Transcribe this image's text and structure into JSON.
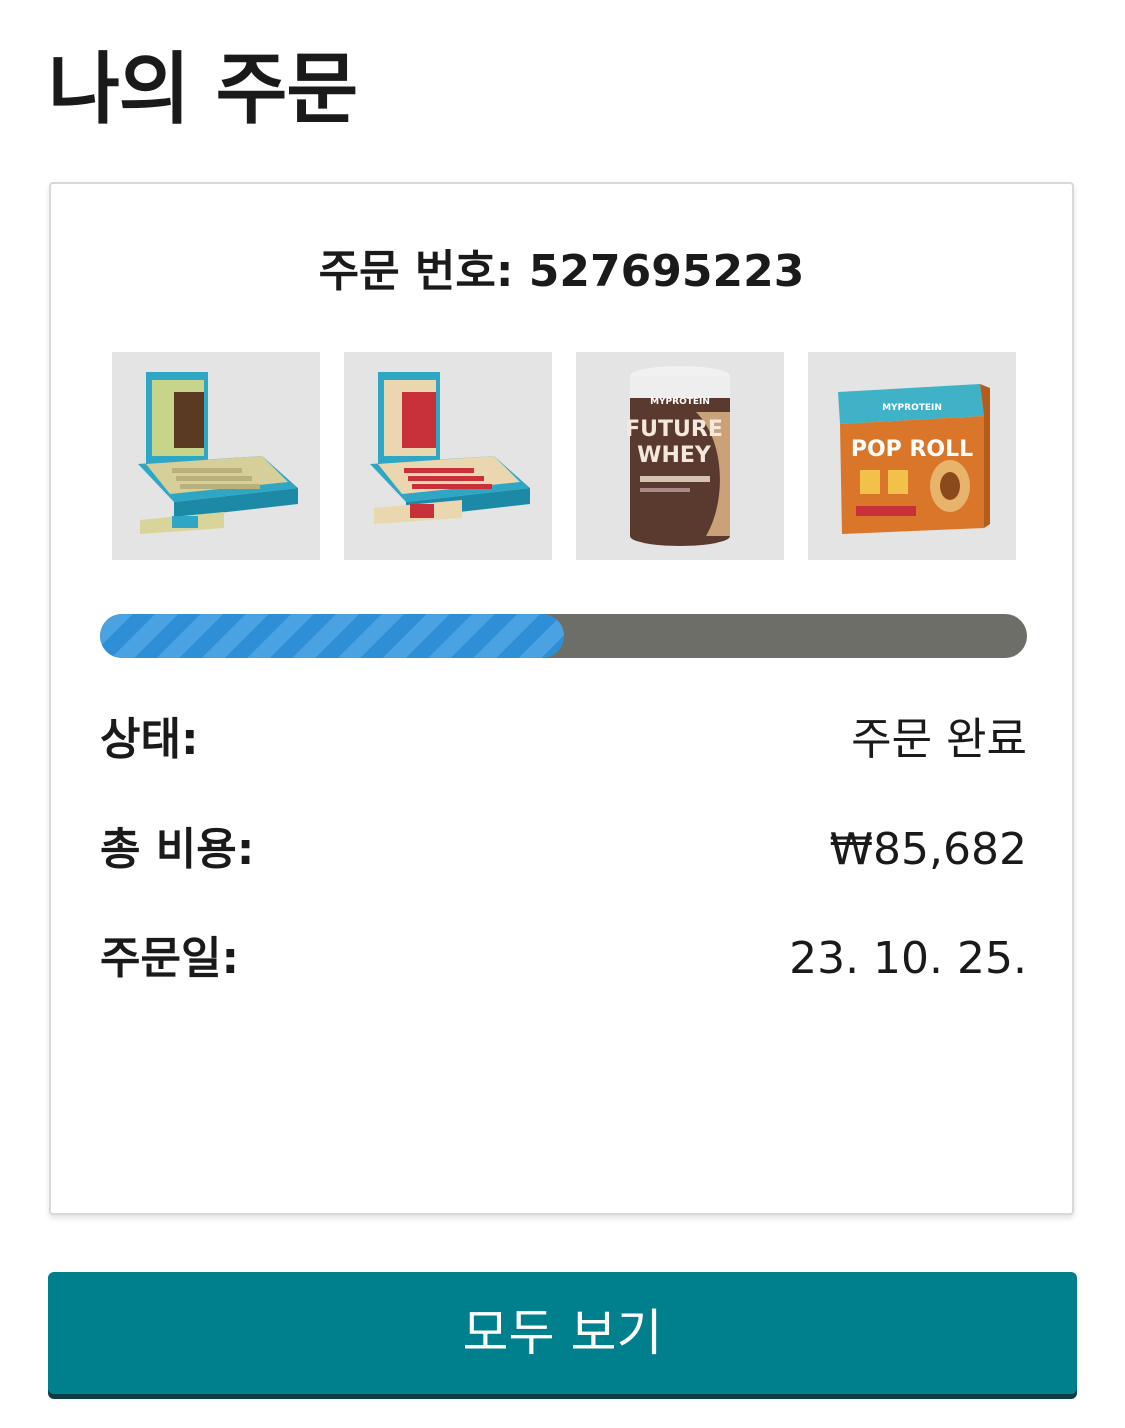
{
  "page": {
    "title": "나의 주문"
  },
  "order": {
    "number_text": "주문 번호: 527695223",
    "progress_fraction": 0.5,
    "products": [
      {
        "icon": "protein-bar-box-green"
      },
      {
        "icon": "protein-bar-box-red"
      },
      {
        "icon": "future-whey-tub"
      },
      {
        "icon": "pop-roll-box"
      }
    ],
    "product_labels": {
      "whey_brand": "MYPROTEIN",
      "whey_name_1": "FUTURE",
      "whey_name_2": "WHEY",
      "roll_brand": "MYPROTEIN",
      "roll_name": "POP ROLL"
    },
    "status_label": "상태:",
    "status_value": "주문 완료",
    "cost_label": "총 비용:",
    "cost_value": "₩85,682",
    "date_label": "주문일:",
    "date_value": "23. 10. 25."
  },
  "actions": {
    "view_all_label": "모두 보기"
  },
  "colors": {
    "button": "#00808c",
    "progress_fill": "#2f8fd6",
    "progress_track": "#6e6e68"
  }
}
